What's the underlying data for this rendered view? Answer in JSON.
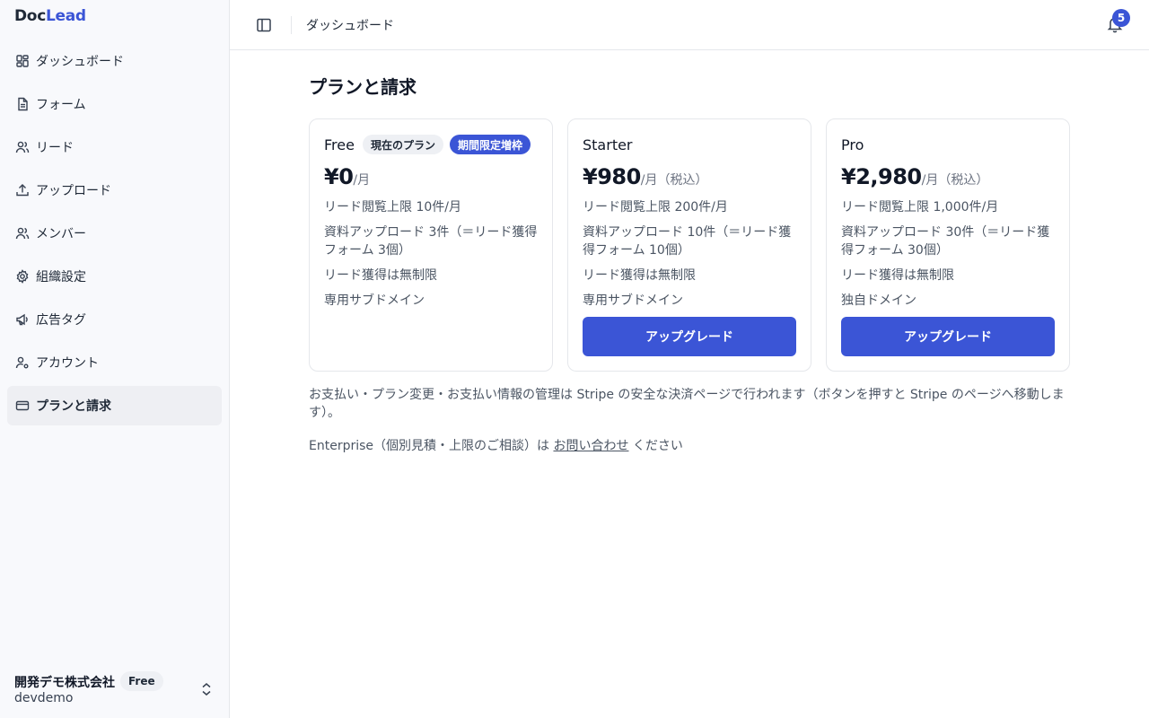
{
  "app": {
    "logo_doc": "Doc",
    "logo_lead": "Lead"
  },
  "sidebar": {
    "items": [
      {
        "label": "ダッシュボード",
        "icon": "dashboard-icon"
      },
      {
        "label": "フォーム",
        "icon": "file-text-icon"
      },
      {
        "label": "リード",
        "icon": "users-icon"
      },
      {
        "label": "アップロード",
        "icon": "upload-icon"
      },
      {
        "label": "メンバー",
        "icon": "members-icon"
      },
      {
        "label": "組織設定",
        "icon": "gear-icon"
      },
      {
        "label": "広告タグ",
        "icon": "megaphone-icon"
      },
      {
        "label": "アカウント",
        "icon": "user-cog-icon"
      },
      {
        "label": "プランと請求",
        "icon": "credit-card-icon",
        "active": true
      }
    ],
    "org": {
      "name": "開発デモ株式会社",
      "plan_badge": "Free",
      "slug": "devdemo"
    }
  },
  "topbar": {
    "title": "ダッシュボード",
    "notification_count": "5"
  },
  "page": {
    "title": "プランと請求"
  },
  "plans": [
    {
      "name": "Free",
      "current_badge": "現在のプラン",
      "promo_badge": "期間限定増枠",
      "price": "¥0",
      "unit": "/月",
      "features": [
        "リード閲覧上限 10件/月",
        "資料アップロード 3件（＝リード獲得フォーム 3個）",
        "リード獲得は無制限",
        "専用サブドメイン"
      ]
    },
    {
      "name": "Starter",
      "price": "¥980",
      "unit": "/月（税込）",
      "features": [
        "リード閲覧上限 200件/月",
        "資料アップロード 10件（＝リード獲得フォーム 10個）",
        "リード獲得は無制限",
        "専用サブドメイン"
      ],
      "button": "アップグレード"
    },
    {
      "name": "Pro",
      "price": "¥2,980",
      "unit": "/月（税込）",
      "features": [
        "リード閲覧上限 1,000件/月",
        "資料アップロード 30件（＝リード獲得フォーム 30個）",
        "リード獲得は無制限",
        "独自ドメイン"
      ],
      "button": "アップグレード"
    }
  ],
  "note": "お支払い・プラン変更・お支払い情報の管理は Stripe の安全な決済ページで行われます（ボタンを押すと Stripe のページへ移動します）。",
  "enterprise": {
    "prefix": "Enterprise（個別見積・上限のご相談）は ",
    "link": "お問い合わせ",
    "suffix": " ください"
  },
  "colors": {
    "accent": "#3b55d6",
    "sidebar_bg": "#f8f9fc"
  }
}
